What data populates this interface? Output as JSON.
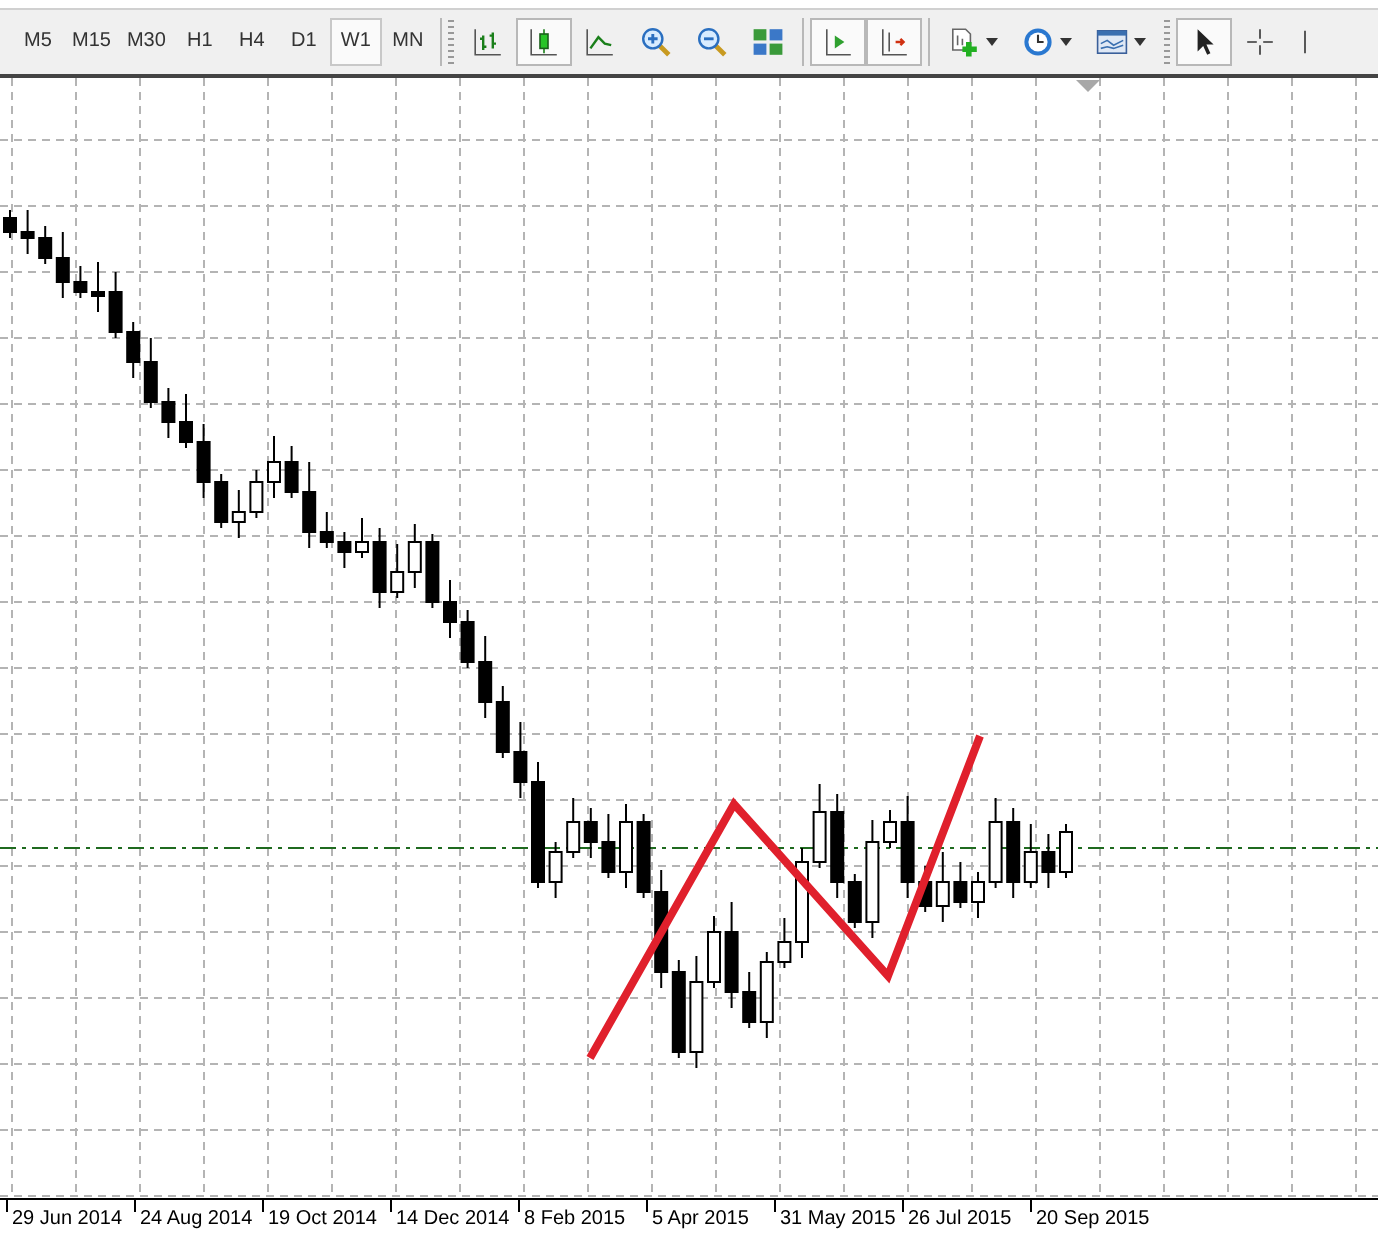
{
  "toolbar": {
    "timeframes": [
      {
        "label": "M5",
        "selected": false
      },
      {
        "label": "M15",
        "selected": false
      },
      {
        "label": "M30",
        "selected": false
      },
      {
        "label": "H1",
        "selected": false
      },
      {
        "label": "H4",
        "selected": false
      },
      {
        "label": "D1",
        "selected": false
      },
      {
        "label": "W1",
        "selected": true
      },
      {
        "label": "MN",
        "selected": false
      }
    ],
    "tools": [
      {
        "kind": "bars",
        "selected": false,
        "dropdown": false
      },
      {
        "kind": "candles",
        "selected": true,
        "dropdown": false
      },
      {
        "kind": "line",
        "selected": false,
        "dropdown": false
      },
      {
        "kind": "zoom_in",
        "selected": false,
        "dropdown": false
      },
      {
        "kind": "zoom_out",
        "selected": false,
        "dropdown": false
      },
      {
        "kind": "tile",
        "selected": false,
        "dropdown": false
      },
      {
        "kind": "separator"
      },
      {
        "kind": "autoscroll",
        "selected": true,
        "dropdown": false
      },
      {
        "kind": "shift",
        "selected": true,
        "dropdown": false
      },
      {
        "kind": "separator"
      },
      {
        "kind": "new_chart",
        "selected": false,
        "dropdown": true
      },
      {
        "kind": "periods",
        "selected": false,
        "dropdown": true
      },
      {
        "kind": "templates",
        "selected": false,
        "dropdown": true
      },
      {
        "kind": "grip"
      },
      {
        "kind": "cursor",
        "selected": true,
        "dropdown": false
      },
      {
        "kind": "crosshair",
        "selected": false,
        "dropdown": false
      },
      {
        "kind": "vline",
        "selected": false,
        "dropdown": false
      }
    ]
  },
  "time_axis": {
    "labels": [
      "29 Jun 2014",
      "24 Aug 2014",
      "19 Oct 2014",
      "14 Dec 2014",
      "8 Feb 2015",
      "5 Apr 2015",
      "31 May 2015",
      "26 Jul 2015",
      "20 Sep 2015"
    ]
  }
}
